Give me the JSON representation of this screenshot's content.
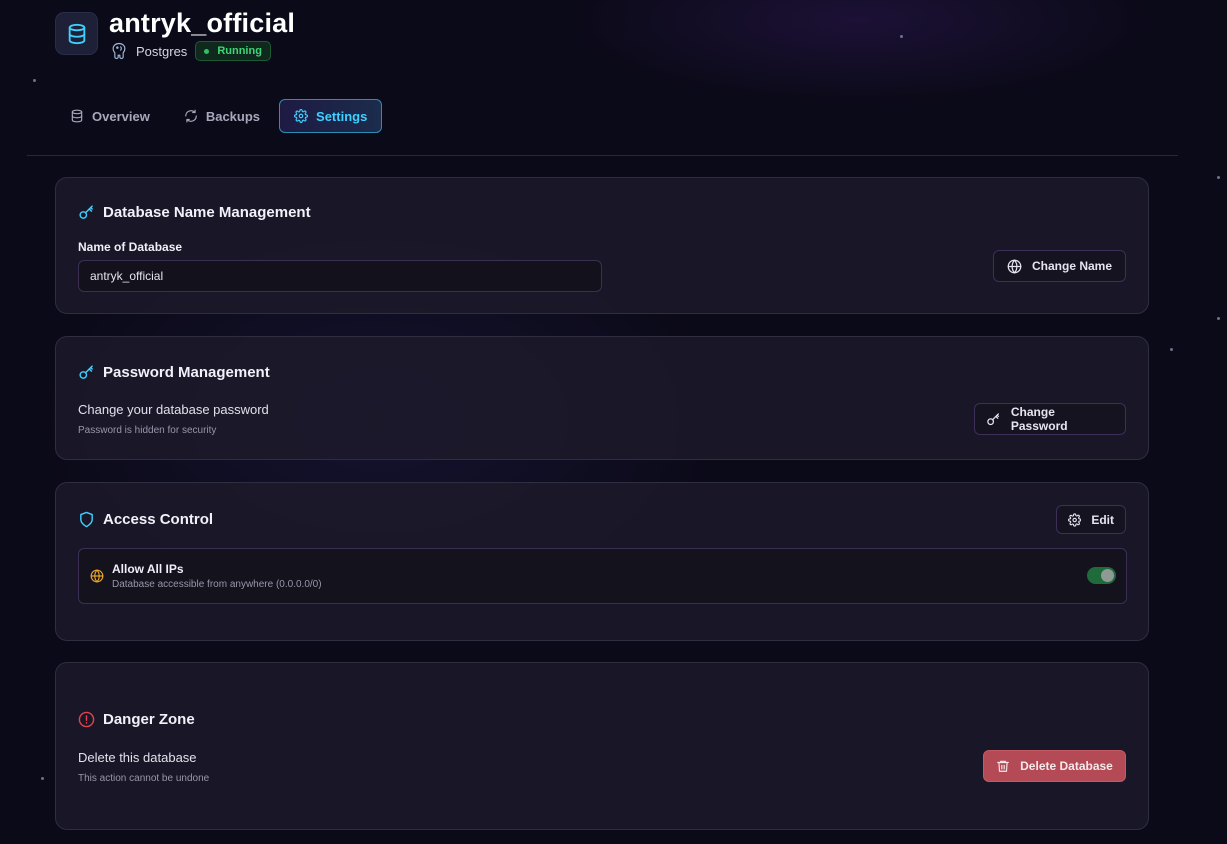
{
  "header": {
    "title": "antryk_official",
    "engine": "Postgres",
    "status": "Running"
  },
  "tabs": [
    {
      "label": "Overview",
      "icon": "database-icon",
      "active": false
    },
    {
      "label": "Backups",
      "icon": "refresh-icon",
      "active": false
    },
    {
      "label": "Settings",
      "icon": "gear-icon",
      "active": true
    }
  ],
  "name_card": {
    "title": "Database Name Management",
    "field_label": "Name of Database",
    "field_value": "antryk_official",
    "button_label": "Change Name"
  },
  "password_card": {
    "title": "Password Management",
    "description": "Change your database password",
    "hint": "Password is hidden for security",
    "button_label": "Change Password"
  },
  "access_card": {
    "title": "Access Control",
    "edit_label": "Edit",
    "allow_all_title": "Allow All IPs",
    "allow_all_desc": "Database accessible from anywhere (0.0.0.0/0)",
    "allow_all_enabled": true
  },
  "danger_card": {
    "title": "Danger Zone",
    "description": "Delete this database",
    "hint": "This action cannot be undone",
    "button_label": "Delete Database"
  },
  "colors": {
    "accent": "#3fd0ff",
    "status_green": "#3fd47a",
    "danger": "#b34a55",
    "warning_icon": "#e8a32a"
  }
}
